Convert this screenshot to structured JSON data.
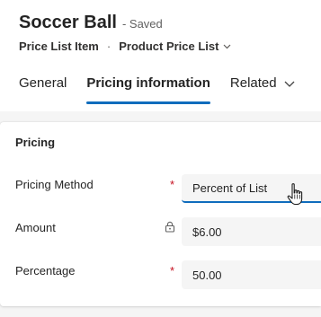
{
  "record": {
    "title": "Soccer Ball",
    "status": "- Saved",
    "entity": "Price List Item",
    "separator": "·",
    "form_name": "Product Price List"
  },
  "tabs": [
    {
      "label": "General"
    },
    {
      "label": "Pricing information"
    },
    {
      "label": "Related"
    }
  ],
  "section": {
    "title": "Pricing"
  },
  "fields": {
    "pricing_method": {
      "label": "Pricing Method",
      "required": "*",
      "value": "Percent of List"
    },
    "amount": {
      "label": "Amount",
      "value": "$6.00"
    },
    "percentage": {
      "label": "Percentage",
      "required": "*",
      "value": "50.00"
    }
  },
  "colors": {
    "accent": "#0f6cbd",
    "required": "#c50f1f"
  }
}
